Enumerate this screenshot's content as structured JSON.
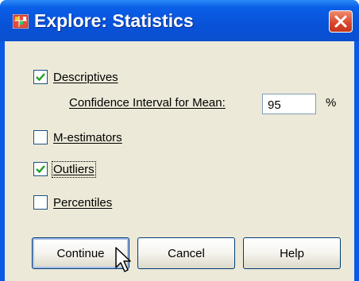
{
  "window": {
    "title": "Explore: Statistics"
  },
  "options": {
    "descriptives": {
      "label": "Descriptives",
      "checked": true
    },
    "confidence_interval": {
      "label": "Confidence Interval for Mean:",
      "value": "95",
      "unit": "%"
    },
    "m_estimators": {
      "label": "M-estimators",
      "checked": false
    },
    "outliers": {
      "label": "Outliers",
      "checked": true
    },
    "percentiles": {
      "label": "Percentiles",
      "checked": false
    }
  },
  "buttons": {
    "continue_label": "Continue",
    "cancel_label": "Cancel",
    "help_label": "Help"
  },
  "icons": {
    "app": "spss-explore-icon",
    "close": "close-icon",
    "check": "check-icon",
    "cursor": "mouse-pointer-icon"
  },
  "colors": {
    "titlebar": "#0a5ae6",
    "dialog_background": "#ece9d8",
    "close_button": "#d9442a",
    "checkmark": "#21a121"
  }
}
